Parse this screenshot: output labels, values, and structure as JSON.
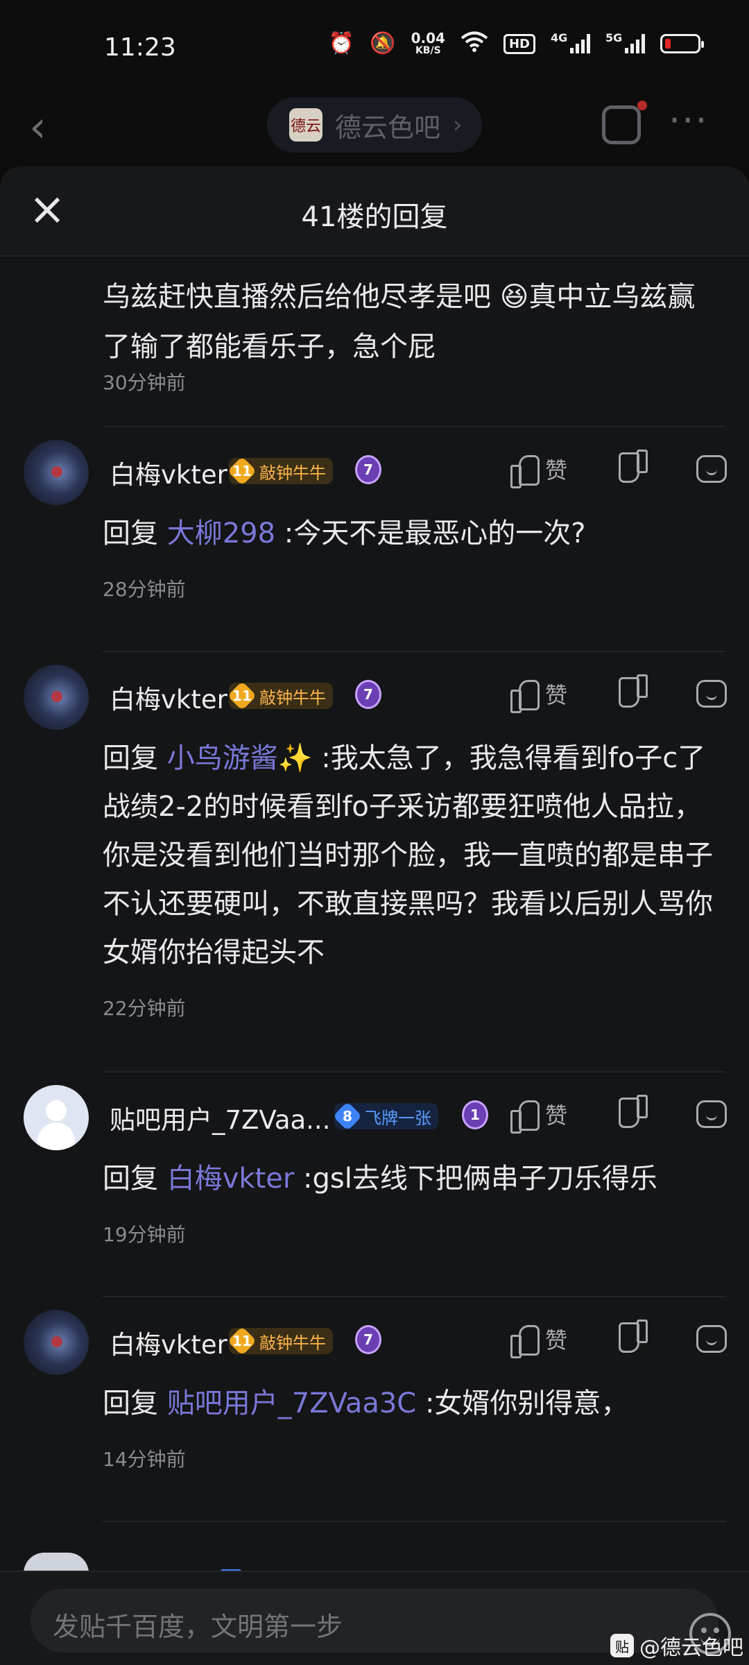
{
  "status_bar": {
    "time": "11:23",
    "net_speed_value": "0.04",
    "net_speed_unit": "KB/S",
    "hd_label": "HD",
    "signal_1_type": "4G",
    "signal_2_type": "5G",
    "battery_color": "#e02626",
    "icons": [
      "alarm-icon",
      "mute-icon",
      "wifi-icon",
      "hd-voice-icon",
      "signal-icon",
      "signal-icon",
      "battery-icon"
    ]
  },
  "navbar": {
    "forum_logo_text": "德云",
    "forum_name": "德云色吧",
    "forum_chevron": "›",
    "back_icon": "‹",
    "more_icon": "···"
  },
  "sheet": {
    "title": "41楼的回复",
    "close_icon": "×"
  },
  "first_reply": {
    "text": "乌兹赶快直播然后给他尽孝是吧 😆真中立乌兹赢了输了都能看乐子，急个屁",
    "time": "30分钟前"
  },
  "comments": [
    {
      "username": "白梅vkter",
      "level": "11",
      "badge_title": "敲钟牛牛",
      "medal": "7",
      "like_label": "赞",
      "reply_prefix": "回复",
      "mention": "大柳298",
      "text": ":今天不是最恶心的一次?",
      "time": "28分钟前"
    },
    {
      "username": "白梅vkter",
      "level": "11",
      "badge_title": "敲钟牛牛",
      "medal": "7",
      "like_label": "赞",
      "reply_prefix": "回复",
      "mention": "小鸟游酱✨",
      "text": ":我太急了，我急得看到fo子c了战绩2-2的时候看到fo子采访都要狂喷他人品拉，你是没看到他们当时那个脸，我一直喷的都是串子不认还要硬叫，不敢直接黑吗？我看以后别人骂你女婿你抬得起头不",
      "time": "22分钟前"
    },
    {
      "username": "贴吧用户_7ZVaa...",
      "level": "8",
      "badge_title": "飞牌一张",
      "medal": "1",
      "like_label": "赞",
      "reply_prefix": "回复",
      "mention": "白梅vkter",
      "text": ":gsl去线下把俩串子刀乐得乐",
      "time": "19分钟前"
    },
    {
      "username": "白梅vkter",
      "level": "11",
      "badge_title": "敲钟牛牛",
      "medal": "7",
      "like_label": "赞",
      "reply_prefix": "回复",
      "mention": "贴吧用户_7ZVaa3C",
      "text": ":女婿你别得意，",
      "time": "14分钟前"
    }
  ],
  "composer": {
    "placeholder": "发贴千百度，文明第一步"
  },
  "watermark": {
    "logo_text": "贴",
    "text": "@德云色吧"
  },
  "colors": {
    "mention": "#7a78d8",
    "gold_badge": "#ffb54a",
    "blue_badge": "#5a9bff",
    "background": "#141516"
  }
}
